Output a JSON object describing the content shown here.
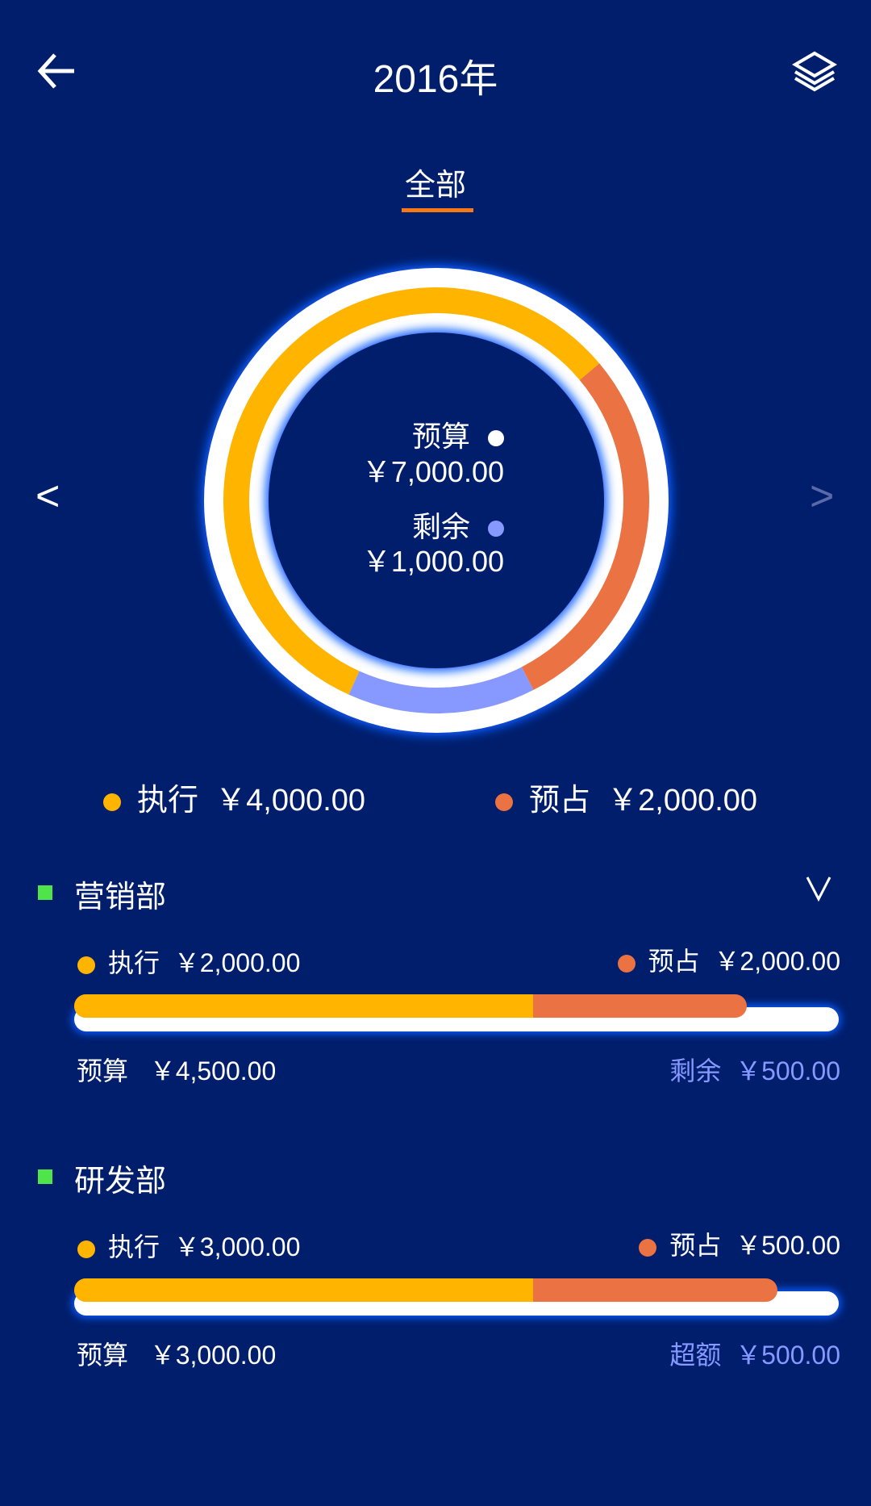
{
  "header": {
    "title": "2016年",
    "back_icon": "arrow-left-icon",
    "layers_icon": "layers-icon"
  },
  "tabs": [
    {
      "label": "全部",
      "active": true
    }
  ],
  "colors": {
    "background": "#001e6c",
    "executed": "#ffb400",
    "reserved": "#ea7243",
    "remaining": "#8799ff",
    "section_marker": "#4ee44a"
  },
  "summary": {
    "budget_label": "预算",
    "budget_value": "￥7,000.00",
    "remaining_label": "剩余",
    "remaining_value": "￥1,000.00",
    "executed_label": "执行",
    "executed_value": "￥4,000.00",
    "reserved_label": "预占",
    "reserved_value": "￥2,000.00",
    "donut": {
      "executed": 4000,
      "reserved": 2000,
      "remaining": 1000
    },
    "prev_label": "<",
    "next_label": ">"
  },
  "departments": [
    {
      "name": "营销部",
      "executed_label": "执行",
      "executed_value": "￥2,000.00",
      "reserved_label": "预占",
      "reserved_value": "￥2,000.00",
      "budget_label": "预算",
      "budget_value": "￥4,500.00",
      "balance_label": "剩余",
      "balance_value": "￥500.00",
      "executed_fill": 0.6,
      "reserved_fill": 0.88,
      "chevron": "chevron-down-icon"
    },
    {
      "name": "研发部",
      "executed_label": "执行",
      "executed_value": "￥3,000.00",
      "reserved_label": "预占",
      "reserved_value": "￥500.00",
      "budget_label": "预算",
      "budget_value": "￥3,000.00",
      "balance_label": "超额",
      "balance_value": "￥500.00",
      "executed_fill": 0.6,
      "reserved_fill": 0.92
    }
  ]
}
